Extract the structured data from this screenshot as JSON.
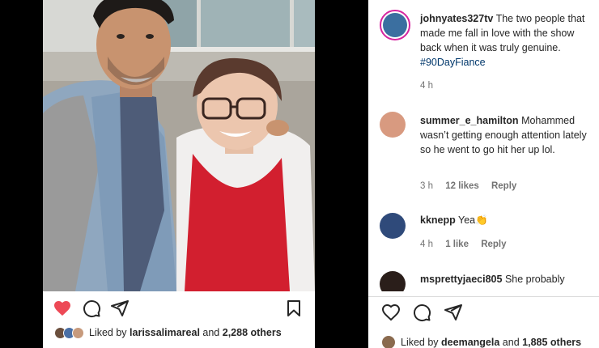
{
  "post": {
    "liked_by_prefix": "Liked by",
    "liked_by_user": "larissalimareal",
    "and_text": "and",
    "others_count": "2,288 others",
    "caption_partial": "· · · · · · · · · · · · · · · ·",
    "icons": [
      "heart-filled-icon",
      "comment-icon",
      "share-icon",
      "bookmark-icon"
    ],
    "heart_color": "#ed4956"
  },
  "comments": [
    {
      "user": "johnyates327tv",
      "text": "The two people that made me fall in love with the show back when it was truly genuine.",
      "tag": "#90DayFiance",
      "time": "4 h"
    },
    {
      "user": "summer_e_hamilton",
      "text": "Mohammed wasn’t getting enough attention lately so he went to go hit her up lol.",
      "time": "3 h",
      "likes": "12 likes",
      "reply": "Reply"
    },
    {
      "user": "kknepp",
      "text": "Yea👏",
      "time": "4 h",
      "likes": "1 like",
      "reply": "Reply"
    },
    {
      "user": "msprettyjaeci805",
      "text": "She probably"
    }
  ],
  "panel": {
    "liked_by_prefix": "Liked by",
    "liked_by_user": "deemangela",
    "and_text": "and",
    "others_count": "1,885 others",
    "icons": [
      "heart-outline-icon",
      "comment-icon",
      "share-icon"
    ]
  }
}
